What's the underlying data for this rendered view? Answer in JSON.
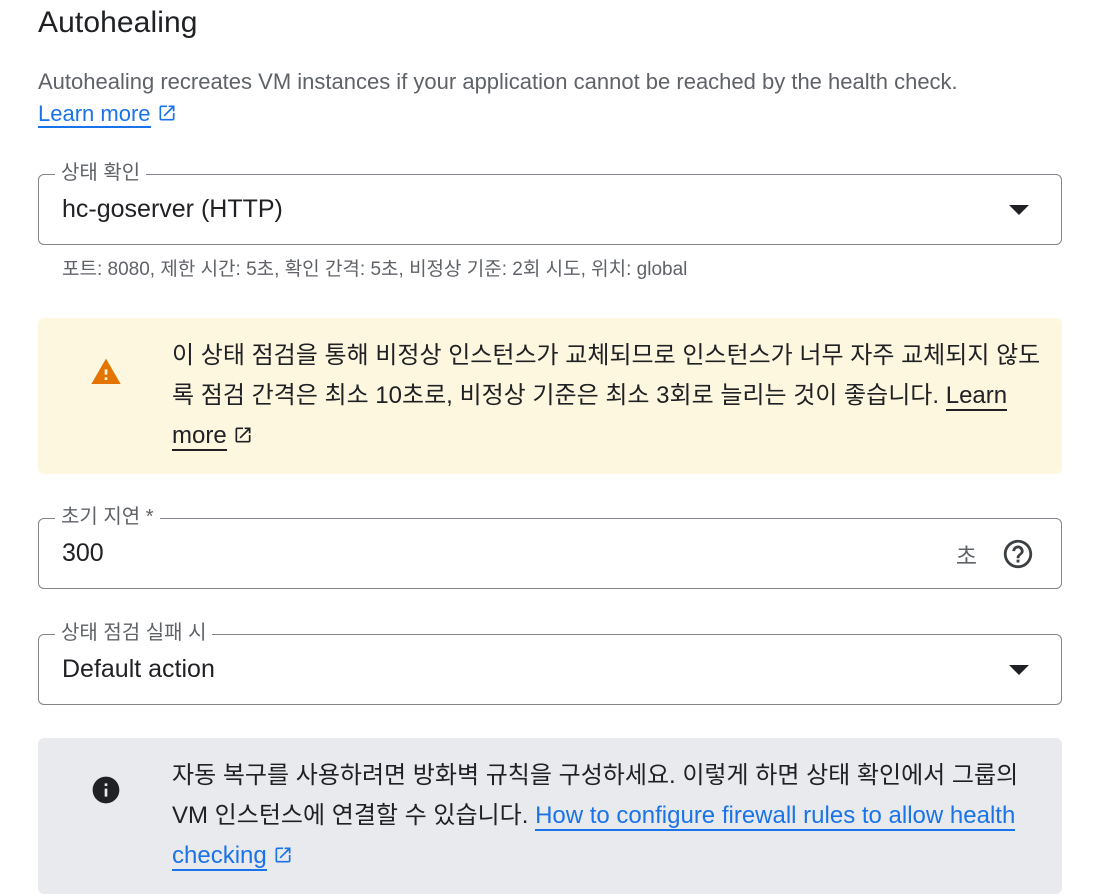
{
  "section": {
    "title": "Autohealing",
    "description": "Autohealing recreates VM instances if your application cannot be reached by the health check.",
    "learn_more": "Learn more"
  },
  "health_check": {
    "label": "상태 확인",
    "value": "hc-goserver (HTTP)",
    "hint": "포트: 8080, 제한 시간: 5초, 확인 간격: 5초, 비정상 기준: 2회 시도, 위치: global"
  },
  "warning_banner": {
    "icon": "warning-icon",
    "text": "이 상태 점검을 통해 비정상 인스턴스가 교체되므로 인스턴스가 너무 자주 교체되지 않도록 점검 간격은 최소 10초로, 비정상 기준은 최소 3회로 늘리는 것이 좋습니다.",
    "link": "Learn more"
  },
  "initial_delay": {
    "label": "초기 지연 *",
    "value": "300",
    "suffix": "초"
  },
  "on_failure": {
    "label": "상태 점검 실패 시",
    "value": "Default action"
  },
  "info_banner": {
    "icon": "info-icon",
    "text": "자동 복구를 사용하려면 방화벽 규칙을 구성하세요. 이렇게 하면 상태 확인에서 그룹의 VM 인스턴스에 연결할 수 있습니다.",
    "link": "How to configure firewall rules to allow health checking"
  },
  "colors": {
    "link": "#1a73e8",
    "warning_bg": "#fef7e0",
    "warning_icon": "#e37400",
    "info_bg": "#e8eaed",
    "text": "#202124",
    "secondary_text": "#5f6368"
  }
}
